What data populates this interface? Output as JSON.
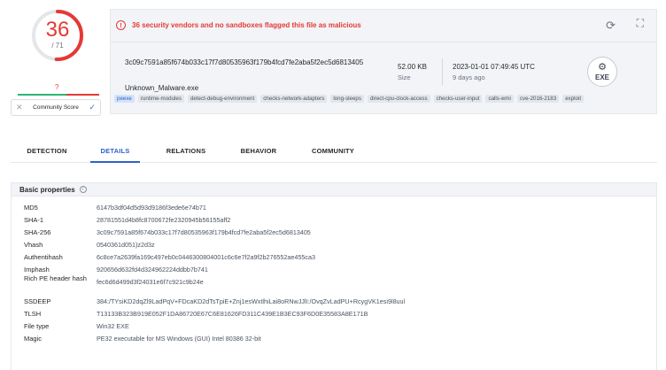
{
  "score": {
    "detections": "36",
    "total": "/ 71",
    "community_value": "?",
    "community_label": "Community Score",
    "colors": {
      "score": "#e53935",
      "ring_track": "#e4e6ea",
      "harmless": "#2bb673"
    }
  },
  "summary": {
    "alert_text": "36 security vendors and no sandboxes flagged this file as malicious",
    "hash": "3c09c7591a85f674b033c17f7d80535963f179b4fcd7fe2aba5f2ec5d6813405",
    "filename": "Unknown_Malware.exe",
    "size_value": "52.00 KB",
    "size_label": "Size",
    "date_value": "2023-01-01 07:49:45 UTC",
    "date_label": "9 days ago",
    "filetype_badge": "EXE",
    "tags": [
      "peexe",
      "runtime-modules",
      "detect-debug-environment",
      "checks-network-adapters",
      "long-sleeps",
      "direct-cpu-clock-access",
      "checks-user-input",
      "calls-wmi",
      "cve-2016-2183",
      "exploit"
    ],
    "icons": [
      "alert-icon",
      "refresh-icon",
      "graph-icon",
      "gears-icon"
    ]
  },
  "tabs": [
    "DETECTION",
    "DETAILS",
    "RELATIONS",
    "BEHAVIOR",
    "COMMUNITY"
  ],
  "active_tab": "DETAILS",
  "basic_properties": {
    "title": "Basic properties",
    "rows": [
      {
        "key": "MD5",
        "value": "6147b3df04d5d93d9186f3ede6e74b71"
      },
      {
        "key": "SHA-1",
        "value": "28781551d4b8fc8700672fe2320945b56155aff2"
      },
      {
        "key": "SHA-256",
        "value": "3c09c7591a85f674b033c17f7d80535963f179b4fcd7fe2aba5f2ec5d6813405"
      },
      {
        "key": "Vhash",
        "value": "0540361d051)z2d3z"
      },
      {
        "key": "Authentihash",
        "value": "6c8ce7a2639fa169c497eb0c0446300804001c6c6e7f2a9f2b276552ae455ca3"
      },
      {
        "key": "Imphash",
        "value": "920656d632fd4d324962224ddbb7b741"
      },
      {
        "key": "Rich PE header hash",
        "value": "fec6d6d499d3f24031e6f7c921c9b24e"
      },
      {
        "key": "SSDEEP",
        "value": "384:/TYsiKD2dqZl9LadPqV+FDcaKD2dTsTpiE+Znj1esWxtlhiLai8oRNwJJlI:/OvqZvLadPU+RcygVK1esi9l8uul"
      },
      {
        "key": "TLSH",
        "value": "T13133B323B919E052F1DA86720E67C6E81626FD311C439E1B3EC93F6D0E35583A8E171B"
      },
      {
        "key": "File type",
        "value": "Win32 EXE"
      },
      {
        "key": "Magic",
        "value": "PE32 executable for MS Windows (GUI) Intel 80386 32-bit"
      }
    ]
  }
}
